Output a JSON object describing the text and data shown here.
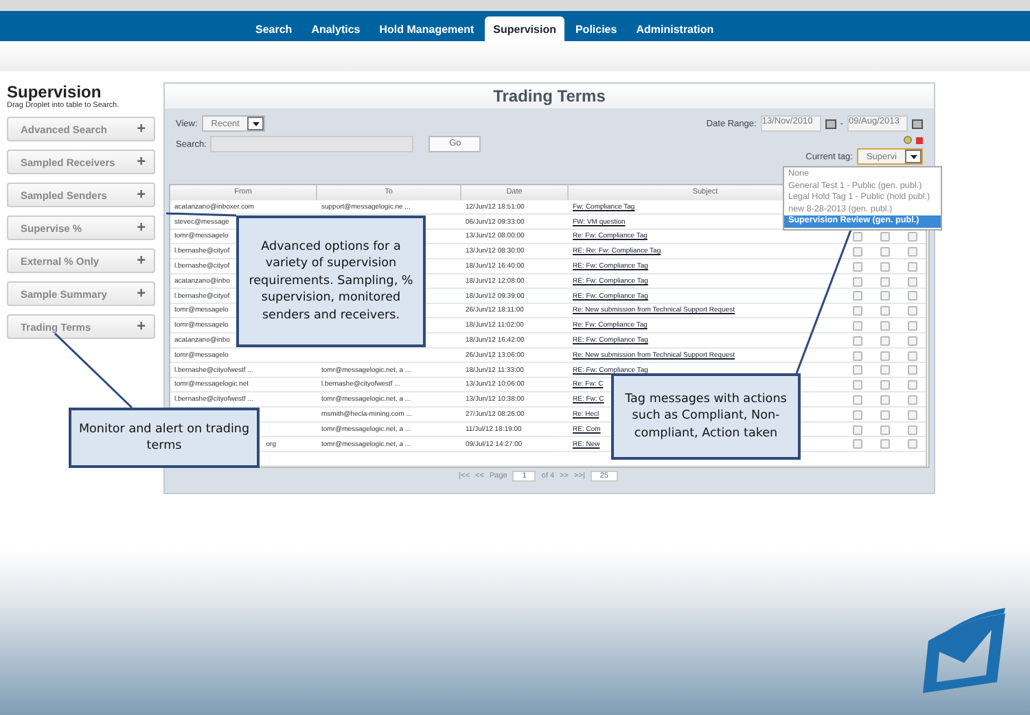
{
  "nav": [
    {
      "label": "Search",
      "selected": false
    },
    {
      "label": "Analytics",
      "selected": false
    },
    {
      "label": "Hold Management",
      "selected": false
    },
    {
      "label": "Supervision",
      "selected": true
    },
    {
      "label": "Policies",
      "selected": false
    },
    {
      "label": "Administration",
      "selected": false
    }
  ],
  "sidebar": {
    "title": "Supervision",
    "hint": "Drag Droplet into table to Search.",
    "items": [
      {
        "label": "Advanced Search",
        "icon": "+"
      },
      {
        "label": "Sampled Receivers",
        "icon": "+"
      },
      {
        "label": "Sampled Senders",
        "icon": "+"
      },
      {
        "label": "Supervise %",
        "icon": "+"
      },
      {
        "label": "External % Only",
        "icon": "+"
      },
      {
        "label": "Sample Summary",
        "icon": "+"
      },
      {
        "label": "Trading Terms",
        "icon": "+"
      }
    ]
  },
  "panel": {
    "title": "Trading Terms",
    "view_label": "View:",
    "view_value": "Recent",
    "search_label": "Search:",
    "go": "Go",
    "date_label": "Date Range:",
    "date_from": "13/Nov/2010",
    "date_sep": "-",
    "date_to": "09/Aug/2013",
    "tag_label": "Current tag:",
    "tag_value": "Supervi",
    "tag_options": [
      {
        "label": "None",
        "selected": false
      },
      {
        "label": "General Test 1 - Public (gen. publ.)",
        "selected": false
      },
      {
        "label": "Legal Hold Tag 1 - Public (hold publ.)",
        "selected": false
      },
      {
        "label": "new 8-28-2013 (gen. publ.)",
        "selected": false
      },
      {
        "label": "Supervision Review (gen. publ.)",
        "selected": true
      }
    ]
  },
  "table": {
    "columns": [
      "From",
      "To",
      "Date",
      "Subject"
    ],
    "rows": [
      {
        "from": "acatanzano@inboxer.com",
        "to": "support@messagelogic.ne ...",
        "date": "12/Jun/12 18:51:00",
        "subject": "Fw: Compliance Tag"
      },
      {
        "from": "stevec@message",
        "to": "",
        "date": "06/Jun/12 09:33:00",
        "subject": "FW: VM question"
      },
      {
        "from": "tomr@messagelo",
        "to": "",
        "date": "13/Jun/12 08:00:00",
        "subject": "Re: Fw: Compliance Tag",
        "checks": [
          false,
          false,
          false
        ]
      },
      {
        "from": "l.bernashe@cityof",
        "to": "",
        "date": "13/Jun/12 08:30:00",
        "subject": "RE: Re: Fw: Compliance Tag",
        "checks": [
          false,
          false,
          false
        ]
      },
      {
        "from": "l.bernashe@cityof",
        "to": "",
        "date": "18/Jun/12 16:40:00",
        "subject": "RE: Fw: Compliance Tag",
        "checks": [
          false,
          false,
          false
        ]
      },
      {
        "from": "acatanzano@inbo",
        "to": "",
        "date": "18/Jun/12 12:08:00",
        "subject": "RE: Fw: Compliance Tag",
        "checks": [
          false,
          false,
          false
        ]
      },
      {
        "from": "l.bernashe@cityof",
        "to": "",
        "date": "18/Jun/12 09:39:00",
        "subject": "RE: Fw: Compliance Tag",
        "checks": [
          false,
          false,
          false
        ]
      },
      {
        "from": "tomr@messagelo",
        "to": "",
        "date": "26/Jun/12 18:11:00",
        "subject": "Re: New submission from Technical Support Request",
        "checks": [
          false,
          false,
          false
        ]
      },
      {
        "from": "tomr@messagelo",
        "to": "",
        "date": "18/Jun/12 11:02:00",
        "subject": "Re: Fw: Compliance Tag",
        "checks": [
          false,
          false,
          false
        ]
      },
      {
        "from": "acatanzano@inbo",
        "to": "",
        "date": "18/Jun/12 16:42:00",
        "subject": "RE: Fw: Compliance Tag",
        "checks": [
          false,
          false,
          false
        ]
      },
      {
        "from": "tomr@messagelo",
        "to": "",
        "date": "26/Jun/12 13:06:00",
        "subject": "Re: New submission from Technical Support Request",
        "checks": [
          false,
          false,
          false
        ]
      },
      {
        "from": "l.bernashe@cityofwestf ...",
        "to": "tomr@messagelogic.net, a ...",
        "date": "18/Jun/12 11:33:00",
        "subject": "RE: Fw: Compliance Tag",
        "checks": [
          false,
          false,
          false
        ]
      },
      {
        "from": "tomr@messagelogic.net",
        "to": "l.bernashe@cityofwestf ...",
        "date": "13/Jun/12 10:06:00",
        "subject": "Re: Fw: C",
        "checks": [
          false,
          false,
          false
        ]
      },
      {
        "from": "l.bernashe@cityofwestf ...",
        "to": "tomr@messagelogic.net, a ...",
        "date": "13/Jun/12 10:38:00",
        "subject": "RE: Fw: C",
        "checks": [
          false,
          false,
          false
        ]
      },
      {
        "from": "",
        "to": "msmith@hecla-mining.com ...",
        "date": "27/Jun/12 08:26:00",
        "subject": "Re: Hecl",
        "checks": [
          false,
          false,
          false
        ]
      },
      {
        "from": "",
        "to": "tomr@messagelogic.net, a ...",
        "date": "11/Jul/12 18:19:00",
        "subject": "RE: Com",
        "checks": [
          false,
          false,
          false
        ]
      },
      {
        "from": "org",
        "tail_only": true,
        "to": "tomr@messagelogic.net, a ...",
        "date": "09/Jul/12 14:27:00",
        "subject": "RE: New",
        "checks": [
          false,
          false,
          false
        ]
      }
    ]
  },
  "pager": {
    "first": "|<<",
    "prev": "<<",
    "page_label": "Page",
    "page": "1",
    "of": "of 4",
    "next": ">>",
    "last": ">>|",
    "size": "25"
  },
  "callouts": [
    {
      "text": "Advanced options for a variety of supervision requirements. Sampling, % supervision, monitored senders and receivers."
    },
    {
      "text": "Monitor and alert  on trading terms"
    },
    {
      "text": "Tag messages with actions such as Compliant, Non-compliant, Action taken"
    }
  ]
}
